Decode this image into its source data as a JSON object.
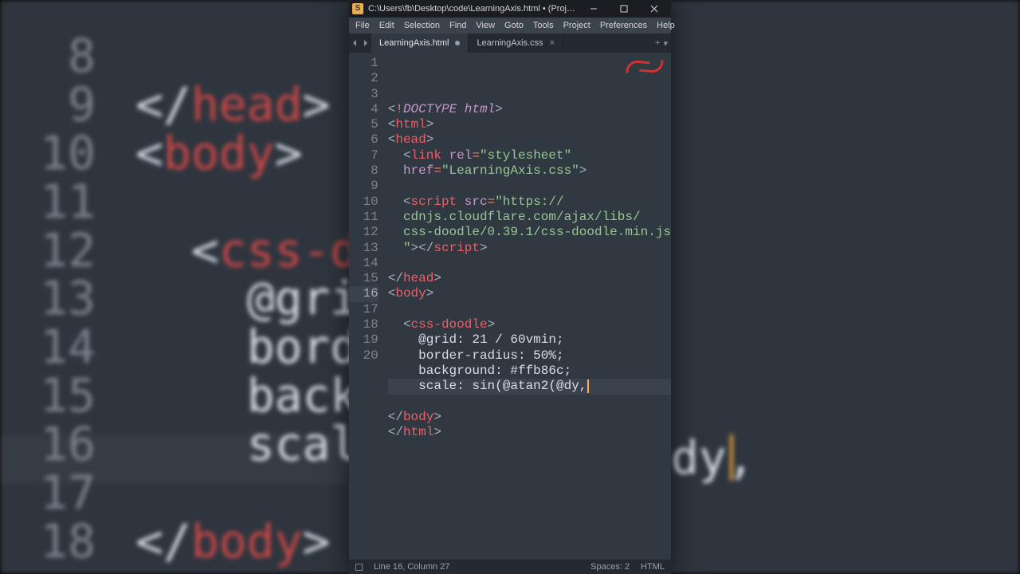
{
  "window": {
    "title": "C:\\Users\\fb\\Desktop\\code\\LearningAxis.html • (Project) - Su..."
  },
  "menu": {
    "file": "File",
    "edit": "Edit",
    "selection": "Selection",
    "find": "Find",
    "view": "View",
    "goto": "Goto",
    "tools": "Tools",
    "project": "Project",
    "prefs": "Preferences",
    "help": "Help"
  },
  "tabs": {
    "active": "LearningAxis.html",
    "inactive": "LearningAxis.css"
  },
  "gutter": {
    "from": 1,
    "to": 20,
    "current": 16
  },
  "status": {
    "pos": "Line 16, Column 27",
    "spaces": "Spaces: 2",
    "syntax": "HTML"
  },
  "code": {
    "file_visible": "LearningAxis.html",
    "l1": {
      "open": "<",
      "bang": "!",
      "doctype": "DOCTYPE",
      "html": "html",
      "close": ">"
    },
    "l2": {
      "open": "<",
      "tag": "html",
      "close": ">"
    },
    "l3": {
      "open": "<",
      "tag": "head",
      "close": ">"
    },
    "l4": {
      "indent": "  ",
      "open": "<",
      "tag": "link",
      "attr1": "rel",
      "eq": "=",
      "q": "\"",
      "val1": "stylesheet"
    },
    "l5": {
      "indent": "  ",
      "attr": "href",
      "eq": "=",
      "q": "\"",
      "val": "LearningAxis.css",
      "close": ">"
    },
    "l6": {
      "blank": ""
    },
    "l7": {
      "indent": "  ",
      "open": "<",
      "tag": "script",
      "attr": "src",
      "eq": "=",
      "q": "\"",
      "val": "https://",
      "cont1": "cdnjs.cloudflare.com/ajax/libs/",
      "cont2": "css-doodle/0.39.1/css-doodle.min.js",
      "endq": "\"",
      "close": ">",
      "openend": "</",
      "tagend": "script",
      "closeend": ">"
    },
    "l8": {
      "blank": ""
    },
    "l9": {
      "open": "</",
      "tag": "head",
      "close": ">"
    },
    "l10": {
      "open": "<",
      "tag": "body",
      "close": ">"
    },
    "l11": {
      "blank": ""
    },
    "l12": {
      "indent": "  ",
      "open": "<",
      "tag": "css-doodle",
      "close": ">"
    },
    "l13": {
      "indent": "    ",
      "text": "@grid: 21 / 60vmin;"
    },
    "l14": {
      "indent": "    ",
      "text": "border-radius: 50%;"
    },
    "l15": {
      "indent": "    ",
      "text": "background: #ffb86c;"
    },
    "l16": {
      "indent": "    ",
      "text": "scale: sin(@atan2(@dy,"
    },
    "l17": {
      "blank": ""
    },
    "l18": {
      "open": "</",
      "tag": "body",
      "close": ">"
    },
    "l19": {
      "open": "</",
      "tag": "html",
      "close": ">"
    },
    "l20": {
      "blank": ""
    }
  },
  "bg": {
    "lines": [
      {
        "n": "8",
        "txt": ""
      },
      {
        "n": "9",
        "txt_open": "</",
        "txt_tag": "head",
        "txt_close": ">"
      },
      {
        "n": "10",
        "txt_open": "<",
        "txt_tag": "body",
        "txt_close": ">"
      },
      {
        "n": "11",
        "txt": ""
      },
      {
        "n": "12",
        "indent": "  ",
        "txt_open": "<",
        "txt_tag": "css-do"
      },
      {
        "n": "13",
        "indent": "    ",
        "plain": "@grid:"
      },
      {
        "n": "14",
        "indent": "    ",
        "plain": "border"
      },
      {
        "n": "15",
        "indent": "    ",
        "plain": "backgr"
      },
      {
        "n": "16",
        "indent": "    ",
        "plain": "scale:"
      },
      {
        "n": "17",
        "txt": ""
      },
      {
        "n": "18",
        "txt_open": "</",
        "txt_tag": "body",
        "txt_close": ">"
      }
    ],
    "right": "\n\n\n\ndy,"
  }
}
